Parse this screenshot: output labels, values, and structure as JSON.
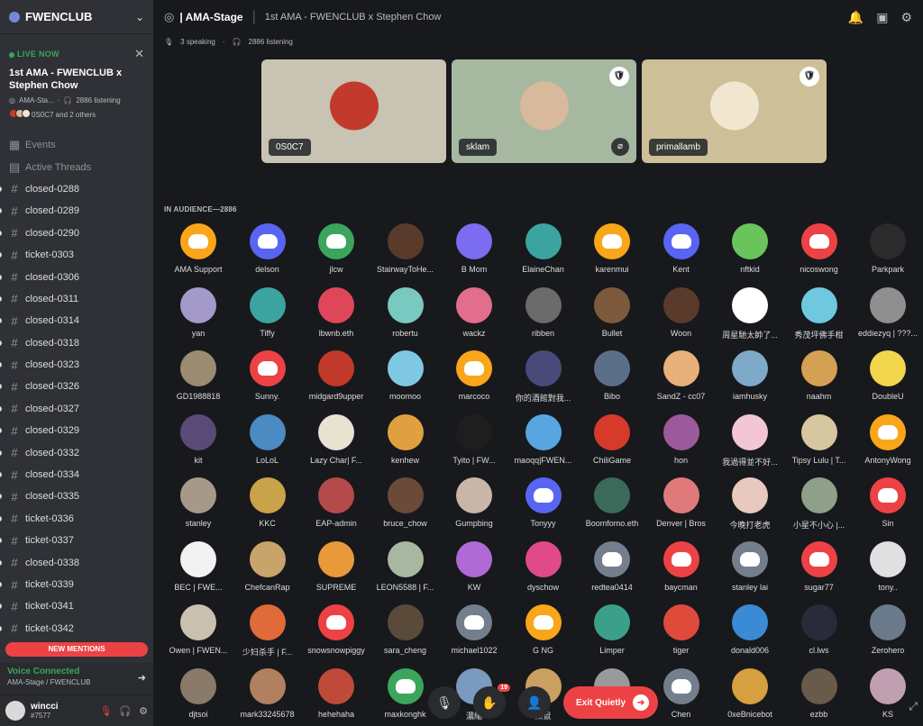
{
  "server": {
    "name": "FWENCLUB"
  },
  "live": {
    "label": "LIVE NOW",
    "title": "1st AMA - FWENCLUB x Stephen Chow",
    "stage": "AMA-Sta...",
    "listening": "2886 listening",
    "others": "0S0C7 and 2 others"
  },
  "channels": [
    {
      "label": "Events",
      "kind": "events"
    },
    {
      "label": "Active Threads",
      "kind": "threads"
    },
    {
      "label": "closed-0288",
      "kind": "text"
    },
    {
      "label": "closed-0289",
      "kind": "text"
    },
    {
      "label": "closed-0290",
      "kind": "text"
    },
    {
      "label": "ticket-0303",
      "kind": "text"
    },
    {
      "label": "closed-0306",
      "kind": "text"
    },
    {
      "label": "closed-0311",
      "kind": "text"
    },
    {
      "label": "closed-0314",
      "kind": "text"
    },
    {
      "label": "closed-0318",
      "kind": "text"
    },
    {
      "label": "closed-0323",
      "kind": "text"
    },
    {
      "label": "closed-0326",
      "kind": "text"
    },
    {
      "label": "closed-0327",
      "kind": "text"
    },
    {
      "label": "closed-0329",
      "kind": "text"
    },
    {
      "label": "closed-0332",
      "kind": "text"
    },
    {
      "label": "closed-0334",
      "kind": "text"
    },
    {
      "label": "closed-0335",
      "kind": "text"
    },
    {
      "label": "ticket-0336",
      "kind": "text"
    },
    {
      "label": "ticket-0337",
      "kind": "text"
    },
    {
      "label": "closed-0338",
      "kind": "text"
    },
    {
      "label": "ticket-0339",
      "kind": "text"
    },
    {
      "label": "ticket-0341",
      "kind": "text"
    },
    {
      "label": "ticket-0342",
      "kind": "text"
    }
  ],
  "new_mentions": "NEW MENTIONS",
  "voice": {
    "title": "Voice Connected",
    "sub": "AMA-Stage / FWENCLUB"
  },
  "user": {
    "name": "wincci",
    "tag": "#7577"
  },
  "topbar": {
    "channel": "| AMA-Stage",
    "topic": "1st AMA - FWENCLUB x Stephen Chow",
    "speaking": "3 speaking",
    "listening": "2886 listening"
  },
  "speakers": [
    {
      "name": "0S0C7",
      "bg": "#c8c3b3",
      "art": "#c23a2b",
      "badge": false,
      "mute": false
    },
    {
      "name": "sklam",
      "bg": "#a7b8a1",
      "art": "#d9b99b",
      "badge": true,
      "mute": true
    },
    {
      "name": "primallamb",
      "bg": "#cdbf98",
      "art": "#f1e6d0",
      "badge": true,
      "mute": false
    }
  ],
  "audience_title": "IN AUDIENCE—2886",
  "audience": [
    {
      "name": "AMA Support",
      "color": "#faa61a",
      "discord": true
    },
    {
      "name": "delson",
      "color": "#5865f2",
      "discord": true
    },
    {
      "name": "jlcw",
      "color": "#3ba55d",
      "discord": true
    },
    {
      "name": "StairwayToHe...",
      "color": "#5a3a2a"
    },
    {
      "name": "B Mom",
      "color": "#7c6cf0"
    },
    {
      "name": "ElaineChan",
      "color": "#3ca4a0"
    },
    {
      "name": "karenmui",
      "color": "#faa61a",
      "discord": true
    },
    {
      "name": "Kent",
      "color": "#5865f2",
      "discord": true
    },
    {
      "name": "nftkid",
      "color": "#6ac35b"
    },
    {
      "name": "nicoswong",
      "color": "#ed4245",
      "discord": true
    },
    {
      "name": "Parkpark",
      "color": "#2b2b2b"
    },
    {
      "name": "yan",
      "color": "#a49ac9"
    },
    {
      "name": "Tiffy",
      "color": "#3ca4a0"
    },
    {
      "name": "lbwnb.eth",
      "color": "#e0465a"
    },
    {
      "name": "robertu",
      "color": "#7ac9c0"
    },
    {
      "name": "wackz",
      "color": "#e06e8c"
    },
    {
      "name": "ribben",
      "color": "#6b6b6b"
    },
    {
      "name": "Bullet",
      "color": "#7d5a3c"
    },
    {
      "name": "Woon",
      "color": "#5a3a2a"
    },
    {
      "name": "周星馳太帥了...",
      "color": "#ffffff"
    },
    {
      "name": "秀茂坪佛手柑",
      "color": "#6ec8e0"
    },
    {
      "name": "eddiezyq | ???...",
      "color": "#8f8f8f"
    },
    {
      "name": "GD1988818",
      "color": "#9b8c6f"
    },
    {
      "name": "Sunny.",
      "color": "#ed4245",
      "discord": true
    },
    {
      "name": "midgard9upper",
      "color": "#c0392b"
    },
    {
      "name": "moomoo",
      "color": "#7ec8e3"
    },
    {
      "name": "marcoco",
      "color": "#faa61a",
      "discord": true
    },
    {
      "name": "你的酒館對我...",
      "color": "#4a4a7a"
    },
    {
      "name": "Bibo",
      "color": "#5c6f88"
    },
    {
      "name": "SandZ - cc07",
      "color": "#e8b17a"
    },
    {
      "name": "iamhusky",
      "color": "#7ea9c9"
    },
    {
      "name": "naahm",
      "color": "#d4a053"
    },
    {
      "name": "DoubleU",
      "color": "#f2d64b"
    },
    {
      "name": "kit",
      "color": "#5a4a7a"
    },
    {
      "name": "LoLoL",
      "color": "#4a8bc4"
    },
    {
      "name": "Lazy Char| F...",
      "color": "#e8e2d0"
    },
    {
      "name": "kenhew",
      "color": "#e0a040"
    },
    {
      "name": "Tyito | FW...",
      "color": "#1e1e1e"
    },
    {
      "name": "maoqq|FWEN...",
      "color": "#58a6e0"
    },
    {
      "name": "ChiliGame",
      "color": "#d63a2a"
    },
    {
      "name": "hon",
      "color": "#9c5a9c"
    },
    {
      "name": "我過得並不好...",
      "color": "#f2c6d2"
    },
    {
      "name": "Tipsy Lulu | T...",
      "color": "#d6c7a1"
    },
    {
      "name": "AntonyWong",
      "color": "#faa61a",
      "discord": true
    },
    {
      "name": "stanley",
      "color": "#a69988"
    },
    {
      "name": "KKC",
      "color": "#c9a24a"
    },
    {
      "name": "EAP-admin",
      "color": "#b54a4a"
    },
    {
      "name": "bruce_chow",
      "color": "#6b4a3a"
    },
    {
      "name": "Gumpbing",
      "color": "#c9b6a9"
    },
    {
      "name": "Tonyyy",
      "color": "#5865f2",
      "discord": true
    },
    {
      "name": "Boomfomo.eth",
      "color": "#3a6a5a"
    },
    {
      "name": "Denver | Bros",
      "color": "#e07a7a"
    },
    {
      "name": "今晚打老虎",
      "color": "#e8c9c0"
    },
    {
      "name": "小星不小心 |...",
      "color": "#8fa08a"
    },
    {
      "name": "Sin",
      "color": "#ed4245",
      "discord": true
    },
    {
      "name": "BEC | FWE...",
      "color": "#f2f2f2"
    },
    {
      "name": "ChefcanRap",
      "color": "#c9a46a"
    },
    {
      "name": "SUPREME",
      "color": "#e89a3a"
    },
    {
      "name": "LEON5588 | F...",
      "color": "#a8b8a0"
    },
    {
      "name": "KW",
      "color": "#b06ad6"
    },
    {
      "name": "dyschow",
      "color": "#e04a8a"
    },
    {
      "name": "redtea0414",
      "color": "#747f8d",
      "discord": true
    },
    {
      "name": "baycman",
      "color": "#ed4245",
      "discord": true
    },
    {
      "name": "stanley lai",
      "color": "#747f8d",
      "discord": true
    },
    {
      "name": "sugar77",
      "color": "#ed4245",
      "discord": true
    },
    {
      "name": "tony..",
      "color": "#e0e0e0"
    },
    {
      "name": "Owen | FWEN...",
      "color": "#c9c0b0"
    },
    {
      "name": "少妇杀手 | F...",
      "color": "#e06a3a"
    },
    {
      "name": "snowsnowpiggy",
      "color": "#ed4245",
      "discord": true
    },
    {
      "name": "sara_cheng",
      "color": "#5a4a3a"
    },
    {
      "name": "michael1022",
      "color": "#747f8d",
      "discord": true
    },
    {
      "name": "G NG",
      "color": "#faa61a",
      "discord": true
    },
    {
      "name": "Limper",
      "color": "#3aa08a"
    },
    {
      "name": "tiger",
      "color": "#e04a3a"
    },
    {
      "name": "donald006",
      "color": "#3a8ad6"
    },
    {
      "name": "cl.lws",
      "color": "#2a2a3a"
    },
    {
      "name": "Zerohero",
      "color": "#6a7a8a"
    },
    {
      "name": "djtsoi",
      "color": "#8a7a6a"
    },
    {
      "name": "mark33245678",
      "color": "#b08060"
    },
    {
      "name": "hehehaha",
      "color": "#c04a3a"
    },
    {
      "name": "maxkonghk",
      "color": "#3ba55d",
      "discord": true
    },
    {
      "name": "濃縮",
      "color": "#7a9ac0"
    },
    {
      "name": "栗鼠",
      "color": "#caa060"
    },
    {
      "name": "mole",
      "color": "#9a9a9a"
    },
    {
      "name": "Chen",
      "color": "#747f8d",
      "discord": true
    },
    {
      "name": "0xeBnicebot",
      "color": "#d6a040"
    },
    {
      "name": "ezbb",
      "color": "#6a5a4a"
    },
    {
      "name": "KS",
      "color": "#c0a0b0"
    }
  ],
  "bottom": {
    "exit": "Exit Quietly",
    "notif": "19"
  }
}
